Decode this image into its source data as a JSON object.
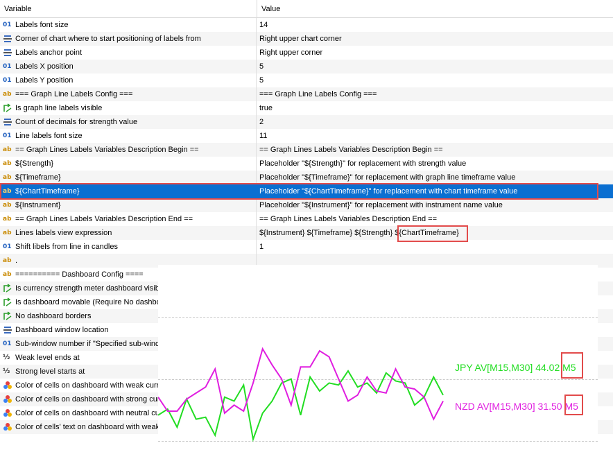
{
  "table": {
    "header": {
      "variable": "Variable",
      "value": "Value"
    },
    "rows": [
      {
        "icon": "num",
        "name": "Labels font size",
        "value": "14"
      },
      {
        "icon": "enum",
        "name": "Corner of chart where to start positioning of labels from",
        "value": "Right upper chart corner"
      },
      {
        "icon": "enum",
        "name": "Labels anchor point",
        "value": "Right upper corner"
      },
      {
        "icon": "num",
        "name": "Labels X position",
        "value": "5"
      },
      {
        "icon": "num",
        "name": "Labels Y position",
        "value": "5"
      },
      {
        "icon": "str",
        "name": "=== Graph Line Labels Config ===",
        "value": "=== Graph Line Labels Config ==="
      },
      {
        "icon": "bool",
        "name": "Is graph line labels visible",
        "value": "true"
      },
      {
        "icon": "enum",
        "name": "Count of decimals for strength value",
        "value": "2"
      },
      {
        "icon": "num",
        "name": "Line labels font size",
        "value": "11"
      },
      {
        "icon": "str",
        "name": "== Graph Lines Labels Variables Description Begin ==",
        "value": "== Graph Lines Labels Variables Description Begin =="
      },
      {
        "icon": "str",
        "name": "${Strength}",
        "value": "Placeholder \"${Strength}\" for replacement with strength value"
      },
      {
        "icon": "str",
        "name": "${Timeframe}",
        "value": "Placeholder \"${Timeframe}\" for replacement with graph line timeframe value"
      },
      {
        "icon": "str",
        "name": "${ChartTimeframe}",
        "value": "Placeholder \"${ChartTimeframe}\" for replacement with chart timeframe value",
        "selected": true
      },
      {
        "icon": "str",
        "name": "${Instrument}",
        "value": "Placeholder \"${Instrument}\" for replacement with instrument name value"
      },
      {
        "icon": "str",
        "name": "== Graph Lines Labels Variables Description End ==",
        "value": "== Graph Lines Labels Variables Description End =="
      },
      {
        "icon": "str",
        "name": "Lines labels view expression",
        "value": "${Instrument} ${Timeframe} ${Strength} ${ChartTimeframe}"
      },
      {
        "icon": "num",
        "name": "Shift libels from line in candles",
        "value": "1"
      },
      {
        "icon": "str",
        "name": ".",
        "value": ""
      },
      {
        "icon": "str",
        "name": "========== Dashboard Config ====",
        "value": ""
      },
      {
        "icon": "bool",
        "name": "Is currency strength meter dashboard visib",
        "value": ""
      },
      {
        "icon": "bool",
        "name": "Is dashboard movable (Require No dashbo",
        "value": ""
      },
      {
        "icon": "bool",
        "name": "No dashboard borders",
        "value": ""
      },
      {
        "icon": "enum",
        "name": "Dashboard window location",
        "value": ""
      },
      {
        "icon": "num",
        "name": "Sub-window number if \"Specified sub-windo",
        "value": ""
      },
      {
        "icon": "frac",
        "name": "Weak level ends at",
        "value": ""
      },
      {
        "icon": "frac",
        "name": "Strong level starts at",
        "value": ""
      },
      {
        "icon": "color",
        "name": "Color of cells on dashboard with weak curre",
        "value": ""
      },
      {
        "icon": "color",
        "name": "Color of cells on dashboard with strong cur",
        "value": ""
      },
      {
        "icon": "color",
        "name": "Color of cells on dashboard with neutral cur",
        "value": ""
      },
      {
        "icon": "color",
        "name": "Color of cells' text on dashboard with weak",
        "value": ""
      }
    ]
  },
  "chart_data": {
    "type": "line",
    "title": "",
    "xlabel": "",
    "ylabel": "",
    "grid": "horizontal dashed lines",
    "series": [
      {
        "name": "JPY AV[M15,M30] 44.02 M5",
        "color": "#22dd22",
        "values": [
          42,
          39,
          48,
          34,
          44,
          43,
          52,
          33,
          35,
          27,
          54,
          41,
          35,
          26,
          24,
          42,
          23,
          30,
          26,
          27,
          20,
          28,
          26,
          31,
          21,
          25,
          26,
          37,
          33,
          23,
          32
        ]
      },
      {
        "name": "NZD AV[M15,M30] 31.50 M5",
        "color": "#e01ee0",
        "values": [
          33,
          40,
          40,
          34,
          31,
          28,
          19,
          41,
          37,
          40,
          26,
          9,
          17,
          24,
          37,
          18,
          18,
          10,
          13,
          24,
          35,
          32,
          23,
          30,
          31,
          19,
          28,
          29,
          33,
          44,
          35
        ]
      }
    ],
    "labels": {
      "jpy": {
        "text": "JPY AV[M15,M30] 44.02 ",
        "tf": "M5"
      },
      "nzd": {
        "text": "NZD AV[M15,M30] 31.50 ",
        "tf": "M5"
      }
    },
    "colors": {
      "jpy": "#22dd22",
      "nzd": "#e01ee0",
      "highlight": "#e24b4b",
      "selection": "#0a6fd1"
    }
  }
}
